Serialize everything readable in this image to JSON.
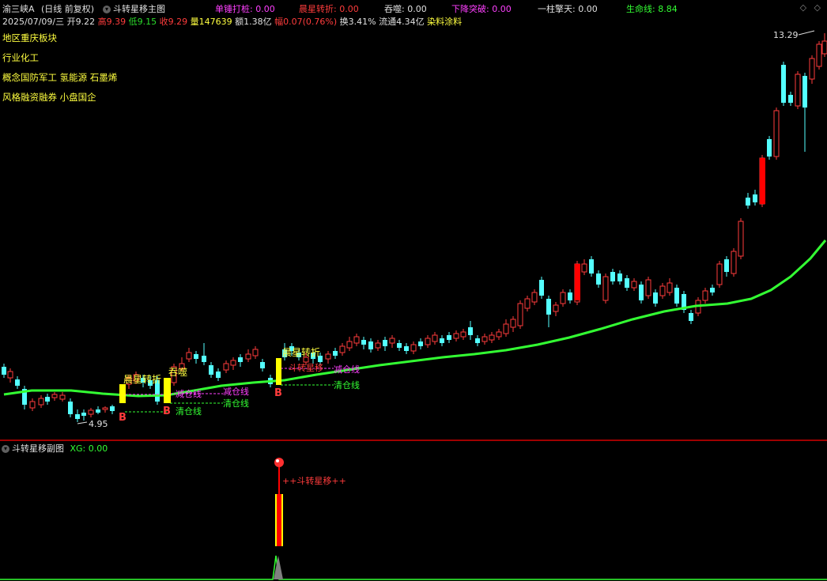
{
  "header": {
    "stock_name": "渝三峡A",
    "period": "(日线 前复权)",
    "main_indicator": "斗转星移主图",
    "stats": [
      {
        "label": "单锤打桩:",
        "value": "0.00",
        "label_color": "#ff40ff",
        "value_color": "#ff40ff"
      },
      {
        "label": "晨星转折:",
        "value": "0.00",
        "label_color": "#ff3c3c",
        "value_color": "#ff3c3c"
      },
      {
        "label": "吞噬:",
        "value": "0.00",
        "label_color": "#e0e0e0",
        "value_color": "#e0e0e0"
      },
      {
        "label": "下降突破:",
        "value": "0.00",
        "label_color": "#ff40ff",
        "value_color": "#ff40ff"
      },
      {
        "label": "一柱擎天:",
        "value": "0.00",
        "label_color": "#e0e0e0",
        "value_color": "#e0e0e0"
      },
      {
        "label": "生命线:",
        "value": "8.84",
        "label_color": "#33ff33",
        "value_color": "#33ff33"
      }
    ]
  },
  "quote": {
    "date": "2025/07/09/三",
    "open_label": "开",
    "open": "9.22",
    "high_label": "高",
    "high": "9.39",
    "low_label": "低",
    "low": "9.15",
    "close_label": "收",
    "close": "9.29",
    "vol_label": "量",
    "vol": "147639",
    "amount_label": "额",
    "amount": "1.38亿",
    "change_label": "幅",
    "change": "0.07(0.76%)",
    "turnover_label": "换",
    "turnover": "3.41%",
    "float_label": "流通",
    "float": "4.34亿",
    "sector": "染料涂料"
  },
  "info": {
    "region": "地区重庆板块",
    "industry": "行业化工",
    "concept": "概念国防军工 氢能源 石墨烯",
    "style": "风格融资融券 小盘国企"
  },
  "price_labels": {
    "high": "13.29",
    "low": "4.95"
  },
  "signals": {
    "morning_star": "晨星转折",
    "engulf": "吞噬",
    "dzxy": "斗转星移",
    "reduce": "减仓线",
    "clear": "清仓线",
    "buy": "B"
  },
  "sub": {
    "title": "斗转星移副图",
    "xg_label": "XG:",
    "xg_value": "0.00",
    "signal": "++斗转星移++"
  },
  "colors": {
    "up": "#ff3c3c",
    "down": "#54ffff",
    "lifeline": "#33ff33",
    "signal": "#ffff00",
    "background": "#000000"
  }
}
